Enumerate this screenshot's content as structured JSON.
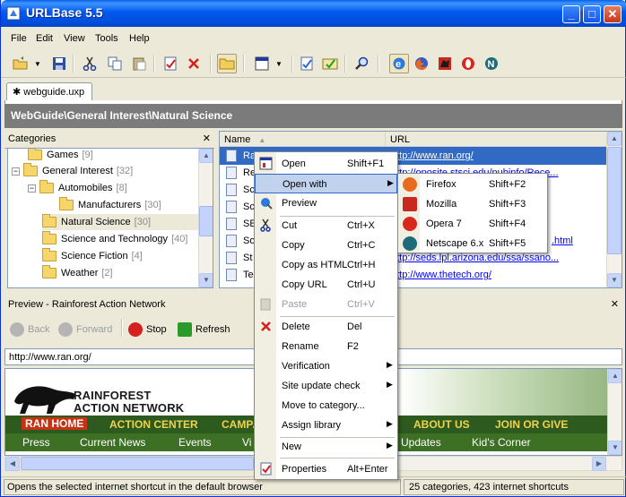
{
  "window": {
    "title": "URLBase 5.5"
  },
  "menubar": [
    "File",
    "Edit",
    "View",
    "Tools",
    "Help"
  ],
  "doc_tab": {
    "label": "webguide.uxp"
  },
  "path": "WebGuide\\General Interest\\Natural Science",
  "categories": {
    "header": "Categories",
    "close": "✕",
    "items": [
      {
        "label": "Games",
        "count": "[9]"
      },
      {
        "label": "General Interest",
        "count": "[32]"
      },
      {
        "label": "Automobiles",
        "count": "[8]"
      },
      {
        "label": "Manufacturers",
        "count": "[30]"
      },
      {
        "label": "Natural Science",
        "count": "[30]"
      },
      {
        "label": "Science and Technology",
        "count": "[40]"
      },
      {
        "label": "Science Fiction",
        "count": "[4]"
      },
      {
        "label": "Weather",
        "count": "[2]"
      }
    ]
  },
  "list": {
    "col_name": "Name",
    "col_url": "URL",
    "rows": [
      {
        "name": "Ra",
        "url": "http://www.ran.org/"
      },
      {
        "name": "Re",
        "url": "http://oposite.stsci.edu/pubinfo/Rece..."
      },
      {
        "name": "Sc",
        "url": ""
      },
      {
        "name": "Sc",
        "url": ""
      },
      {
        "name": "SE",
        "url": ""
      },
      {
        "name": "So",
        "url": ".html"
      },
      {
        "name": "St",
        "url": "http://seds.lpl.arizona.edu/ssa/ssano..."
      },
      {
        "name": "Te",
        "url": "http://www.thetech.org/"
      }
    ]
  },
  "context_menu": {
    "open": {
      "label": "Open",
      "shortcut": "Shift+F1"
    },
    "open_with": {
      "label": "Open with"
    },
    "preview": {
      "label": "Preview"
    },
    "cut": {
      "label": "Cut",
      "shortcut": "Ctrl+X"
    },
    "copy": {
      "label": "Copy",
      "shortcut": "Ctrl+C"
    },
    "copy_html": {
      "label": "Copy as HTML",
      "shortcut": "Ctrl+H"
    },
    "copy_url": {
      "label": "Copy URL",
      "shortcut": "Ctrl+U"
    },
    "paste": {
      "label": "Paste",
      "shortcut": "Ctrl+V"
    },
    "delete": {
      "label": "Delete",
      "shortcut": "Del"
    },
    "rename": {
      "label": "Rename",
      "shortcut": "F2"
    },
    "verification": {
      "label": "Verification"
    },
    "site_update": {
      "label": "Site update check"
    },
    "move": {
      "label": "Move to category..."
    },
    "assign": {
      "label": "Assign library"
    },
    "new": {
      "label": "New"
    },
    "properties": {
      "label": "Properties",
      "shortcut": "Alt+Enter"
    }
  },
  "submenu": [
    {
      "label": "Firefox",
      "shortcut": "Shift+F2",
      "color": "#e66b1f"
    },
    {
      "label": "Mozilla",
      "shortcut": "Shift+F3",
      "color": "#c8281e"
    },
    {
      "label": "Opera 7",
      "shortcut": "Shift+F4",
      "color": "#d8281e"
    },
    {
      "label": "Netscape 6.x",
      "shortcut": "Shift+F5",
      "color": "#1e6b7a"
    }
  ],
  "preview": {
    "title": "Preview - Rainforest Action Network",
    "close": "✕",
    "back": "Back",
    "forward": "Forward",
    "stop": "Stop",
    "refresh": "Refresh",
    "address": "http://www.ran.org/"
  },
  "webpage": {
    "logo_line1": "RAINFOREST",
    "logo_line2": "ACTION NETWORK",
    "nav1": [
      "RAN HOME",
      "ACTION CENTER",
      "CAMPA",
      "ABOUT US",
      "JOIN OR GIVE"
    ],
    "nav2": [
      "Press",
      "Current News",
      "Events",
      "Vi",
      "Updates",
      "Kid's Corner"
    ]
  },
  "status": {
    "left": "Opens the selected internet shortcut in the default browser",
    "right": "25 categories, 423 internet shortcuts"
  },
  "colors": {
    "titlebar": "#0058ee",
    "selection": "#316ac5",
    "menu_highlight": "#c1d2ee",
    "ran_green": "#2d5a1e",
    "ran_yellow": "#f2d24a"
  }
}
